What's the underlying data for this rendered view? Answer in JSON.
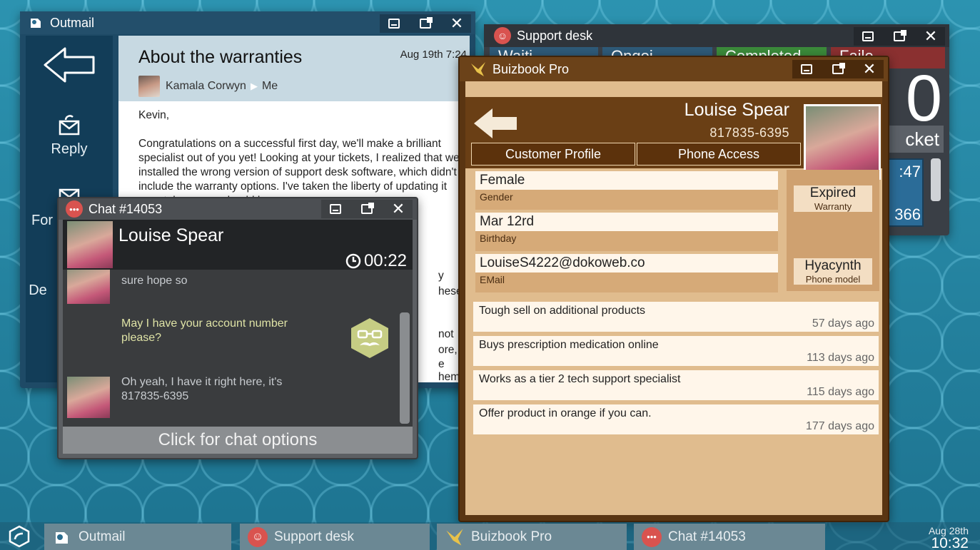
{
  "outmail": {
    "title": "Outmail",
    "subject": "About the warranties",
    "date": "Aug 19th 7:24",
    "from": "Kamala Corwyn",
    "to": "Me",
    "sidebar": {
      "reply": "Reply",
      "forward_fragment": "For",
      "delete_fragment": "De"
    },
    "greeting": "Kevin,",
    "body": "Congratulations on a successful first day, we'll make a brilliant specialist out of you yet! Looking at your tickets, I realized that we installed the wrong version of support desk software, which didn't include the warranty options. I've taken the liberty of updating it remotely, so you should be",
    "right_fragments": [
      "y",
      "hese",
      "not",
      "ore,",
      "e",
      "hem."
    ]
  },
  "support": {
    "title": "Support desk",
    "tabs": [
      "Waiti",
      "Ongoi",
      "Completed",
      "Faile"
    ],
    "big_number_fragment": "0",
    "ticket_fragment": "cket",
    "time_fragment": ":47",
    "number_fragment": "366"
  },
  "buizbook": {
    "title": "Buizbook Pro",
    "name": "Louise Spear",
    "phone": "817835-6395",
    "tabs": {
      "profile": "Customer Profile",
      "phone": "Phone Access"
    },
    "fields": [
      {
        "value": "Female",
        "label": "Gender"
      },
      {
        "value": "Mar 12rd",
        "label": "Birthday"
      },
      {
        "value": "LouiseS4222@dokoweb.co",
        "label": "EMail"
      }
    ],
    "warranty": {
      "value": "Expired",
      "label": "Warranty"
    },
    "phone_model": {
      "value": "Hyacynth",
      "label": "Phone model"
    },
    "notes": [
      {
        "text": "Tough sell on additional products",
        "ago": "57 days ago"
      },
      {
        "text": "Buys prescription medication online",
        "ago": "113 days ago"
      },
      {
        "text": "Works as a tier 2 tech support specialist",
        "ago": "115 days ago"
      },
      {
        "text": "Offer product in orange if you can.",
        "ago": "177 days ago"
      }
    ]
  },
  "chat": {
    "title": "Chat #14053",
    "customer": "Louise Spear",
    "timer": "00:22",
    "messages": [
      {
        "from": "customer",
        "text": "sure hope so"
      },
      {
        "from": "agent",
        "text": "May I have your account number please?"
      },
      {
        "from": "customer",
        "text": "Oh yeah, I have it right here, it's 817835-6395"
      }
    ],
    "options_label": "Click for chat options"
  },
  "taskbar": {
    "items": [
      "Outmail",
      "Support desk",
      "Buizbook Pro",
      "Chat #14053"
    ],
    "date": "Aug 28th",
    "time": "10:32"
  },
  "colors": {
    "desktop": "#2a8aa6",
    "buizbook_brown": "#6a3f15",
    "chat_agent_text": "#dfe3a6",
    "support_completed": "#3b8a3a",
    "support_failed": "#8a3030"
  }
}
